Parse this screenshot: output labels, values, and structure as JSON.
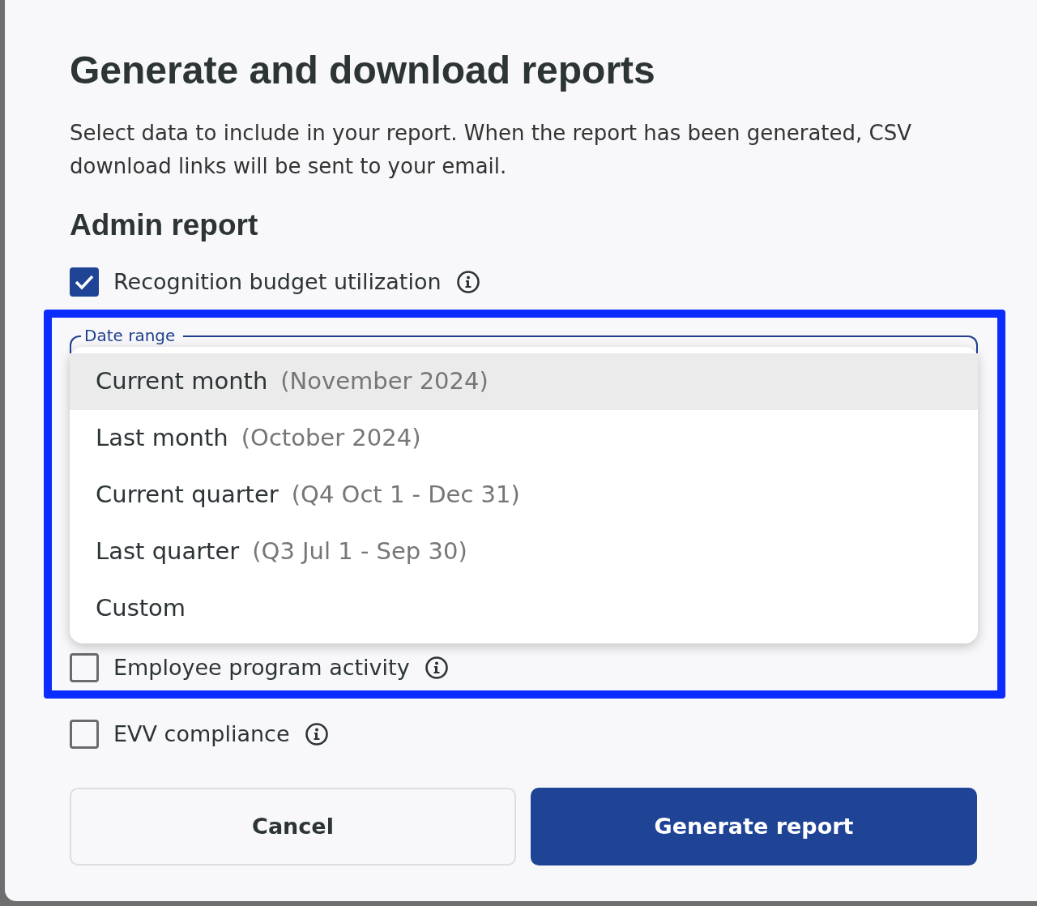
{
  "dialog": {
    "title": "Generate and download reports",
    "description": "Select data to include in your report. When the report has been generated, CSV download links will be sent to your email.",
    "section_title": "Admin report",
    "options": [
      {
        "label": "Recognition budget utilization",
        "checked": true,
        "info": true
      }
    ],
    "date_range": {
      "label": "Date range",
      "highlighted": true,
      "expanded": true,
      "menu": [
        {
          "label": "Current month",
          "detail": "(November 2024)",
          "selected": true
        },
        {
          "label": "Last month",
          "detail": "(October 2024)",
          "selected": false
        },
        {
          "label": "Current quarter",
          "detail": "(Q4 Oct 1 - Dec 31)",
          "selected": false
        },
        {
          "label": "Last quarter",
          "detail": "(Q3 Jul 1 - Sep 30)",
          "selected": false
        },
        {
          "label": "Custom",
          "selected": false
        }
      ],
      "options": [
        {
          "label": "Employee program activity",
          "checked": false,
          "info": true
        }
      ]
    },
    "options_after": [
      {
        "label": "EVV compliance",
        "checked": false,
        "info": true
      }
    ],
    "buttons": [
      {
        "label": "Cancel",
        "kind": "secondary"
      },
      {
        "label": "Generate report",
        "kind": "primary"
      }
    ]
  }
}
